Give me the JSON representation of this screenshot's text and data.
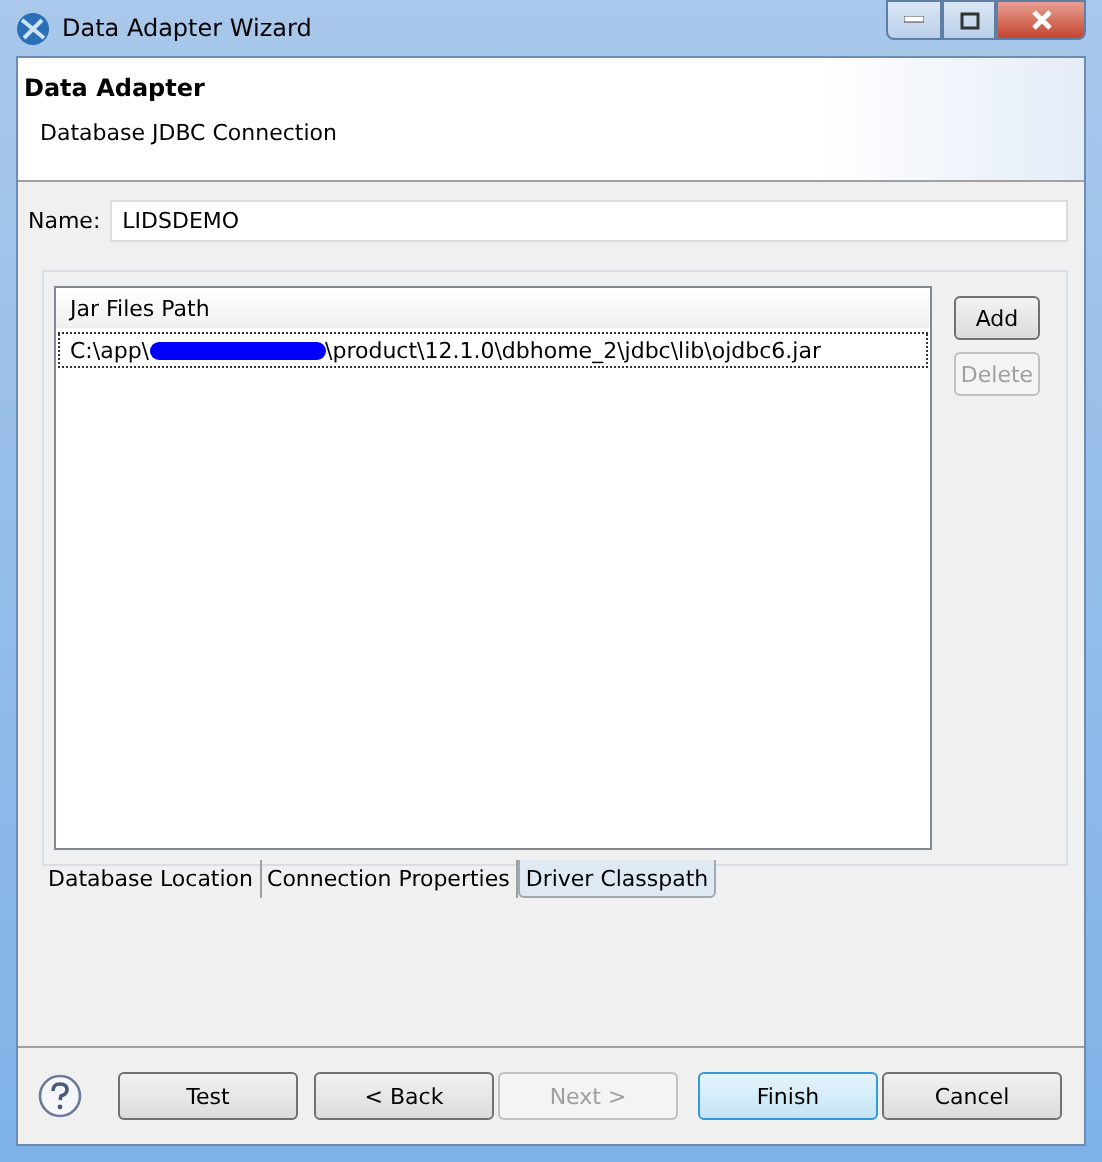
{
  "window": {
    "title": "Data Adapter Wizard"
  },
  "header": {
    "title": "Data Adapter",
    "subtitle": "Database JDBC Connection"
  },
  "name_field": {
    "label": "Name:",
    "value": "LIDSDEMO"
  },
  "jar_table": {
    "column": "Jar Files Path",
    "rows": [
      {
        "path_start": "C:\\app\\",
        "path_end": "\\product\\12.1.0\\dbhome_2\\jdbc\\lib\\ojdbc6.jar",
        "redacted": true,
        "selected": true
      }
    ]
  },
  "side_buttons": [
    {
      "label": "Add",
      "disabled": false
    },
    {
      "label": "Delete",
      "disabled": true
    }
  ],
  "tabs": [
    {
      "label": "Database Location",
      "selected": false
    },
    {
      "label": "Connection Properties",
      "selected": false
    },
    {
      "label": "Driver Classpath",
      "selected": true
    }
  ],
  "footer_buttons": [
    {
      "label": "Test",
      "disabled": false,
      "default": false
    },
    {
      "label": "< Back",
      "disabled": false,
      "default": false
    },
    {
      "label": "Next >",
      "disabled": true,
      "default": false
    },
    {
      "label": "Finish",
      "disabled": false,
      "default": true
    },
    {
      "label": "Cancel",
      "disabled": false,
      "default": false
    }
  ]
}
